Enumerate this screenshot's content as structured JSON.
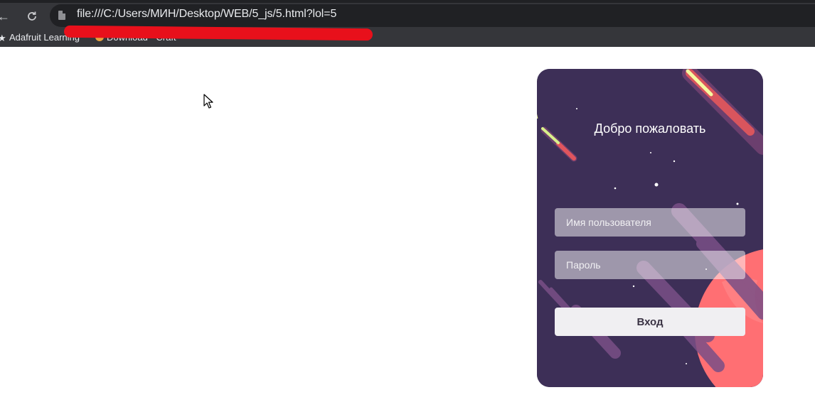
{
  "browser": {
    "url": "file:///C:/Users/МИН/Desktop/WEB/5_js/5.html?lol=5",
    "back_icon": "arrow-left-icon",
    "reload_icon": "reload-icon",
    "bookmarks": [
      {
        "label": "Adafruit Learning",
        "icon": "star-icon"
      },
      {
        "label": "Download - Craft",
        "icon": "site-icon"
      }
    ]
  },
  "login": {
    "title": "Добро пожаловать",
    "username_placeholder": "Имя пользователя",
    "password_placeholder": "Пароль",
    "submit_label": "Вход",
    "background_color": "#3d2f57",
    "accent_color": "#ff6f73"
  }
}
